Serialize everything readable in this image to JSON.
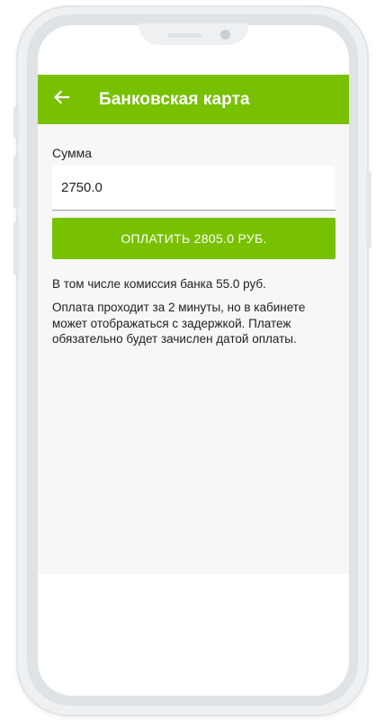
{
  "app_bar": {
    "title": "Банковская карта",
    "back_icon": "arrow-left-icon",
    "color": "#78c100"
  },
  "form": {
    "amount_label": "Сумма",
    "amount_value": "2750.0",
    "pay_button_label": "ОПЛАТИТЬ 2805.0 РУБ."
  },
  "info": {
    "commission": "В том числе комиссия банка 55.0 руб.",
    "notice": "Оплата проходит за 2 минуты, но в кабинете может отображаться с задержкой. Платеж обязательно будет зачислен датой оплаты."
  }
}
